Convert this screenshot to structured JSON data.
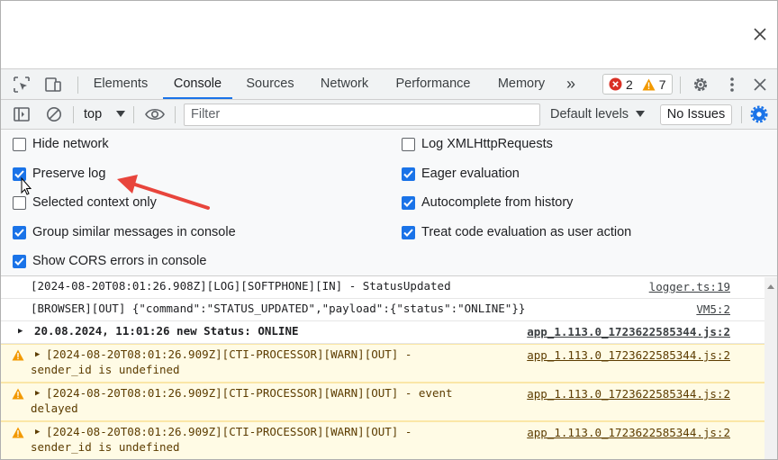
{
  "tabs": [
    {
      "label": "Elements",
      "active": false
    },
    {
      "label": "Console",
      "active": true
    },
    {
      "label": "Sources",
      "active": false
    },
    {
      "label": "Network",
      "active": false
    },
    {
      "label": "Performance",
      "active": false
    },
    {
      "label": "Memory",
      "active": false
    }
  ],
  "more_tabs_glyph": "»",
  "error_count": "2",
  "warning_count": "7",
  "toolbar": {
    "context": "top",
    "filter_placeholder": "Filter",
    "default_levels": "Default levels",
    "no_issues": "No Issues"
  },
  "settings": {
    "left": [
      {
        "label": "Hide network",
        "checked": false
      },
      {
        "label": "Preserve log",
        "checked": true
      },
      {
        "label": "Selected context only",
        "checked": false
      },
      {
        "label": "Group similar messages in console",
        "checked": true
      },
      {
        "label": "Show CORS errors in console",
        "checked": true
      }
    ],
    "right": [
      {
        "label": "Log XMLHttpRequests",
        "checked": false
      },
      {
        "label": "Eager evaluation",
        "checked": true
      },
      {
        "label": "Autocomplete from history",
        "checked": true
      },
      {
        "label": "Treat code evaluation as user action",
        "checked": true
      }
    ]
  },
  "messages": [
    {
      "level": "info",
      "text": "[2024-08-20T08:01:26.908Z][LOG][SOFTPHONE][IN] - StatusUpdated",
      "source": "logger.ts:19"
    },
    {
      "level": "info",
      "text": "[BROWSER][OUT] {\"command\":\"STATUS_UPDATED\",\"payload\":{\"status\":\"ONLINE\"}}",
      "source": "VM5:2"
    },
    {
      "level": "group",
      "text": "20.08.2024, 11:01:26 new Status: ONLINE",
      "source": "app_1.113.0_1723622585344.js:2"
    },
    {
      "level": "warn",
      "text": "[2024-08-20T08:01:26.909Z][CTI-PROCESSOR][WARN][OUT] -",
      "text2": "sender_id is undefined",
      "source": "app_1.113.0_1723622585344.js:2"
    },
    {
      "level": "warn",
      "text": "[2024-08-20T08:01:26.909Z][CTI-PROCESSOR][WARN][OUT] - event",
      "text2": "delayed",
      "source": "app_1.113.0_1723622585344.js:2"
    },
    {
      "level": "warn",
      "text": "[2024-08-20T08:01:26.909Z][CTI-PROCESSOR][WARN][OUT] -",
      "text2": "sender_id is undefined",
      "source": "app_1.113.0_1723622585344.js:2"
    }
  ],
  "colors": {
    "accent": "#1a73e8",
    "error": "#d93025",
    "warning": "#f29900",
    "annotation_arrow": "#e8453c"
  }
}
